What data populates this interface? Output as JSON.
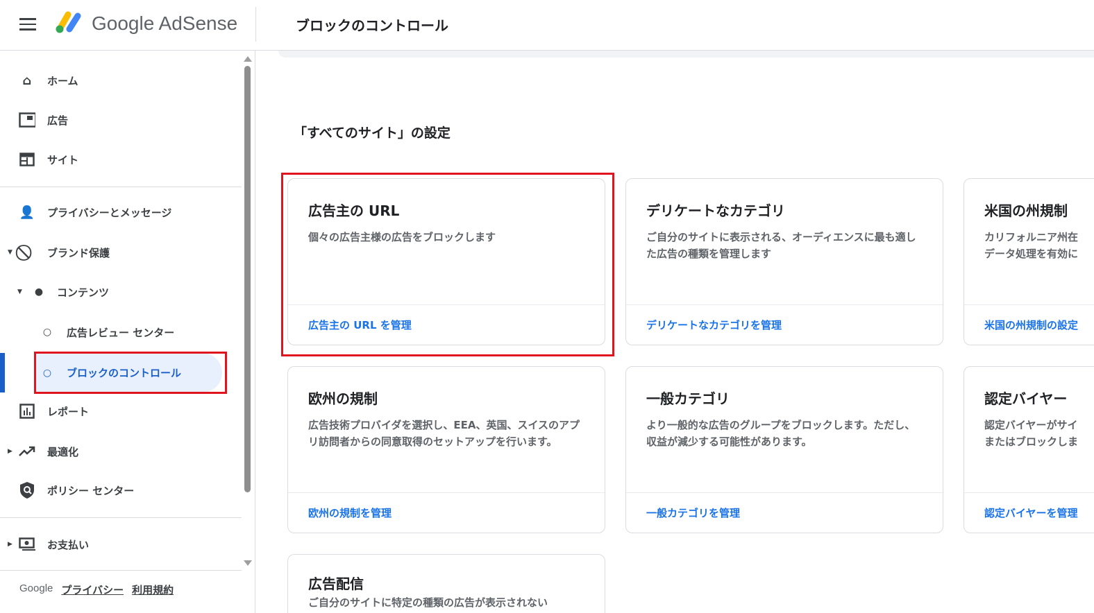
{
  "header": {
    "brand": "Google AdSense",
    "page_title": "ブロックのコントロール"
  },
  "sidebar": {
    "items": [
      {
        "label": "ホーム",
        "icon": "home-icon"
      },
      {
        "label": "広告",
        "icon": "ads-icon"
      },
      {
        "label": "サイト",
        "icon": "sites-icon"
      },
      {
        "label": "プライバシーとメッセージ",
        "icon": "privacy-icon"
      },
      {
        "label": "ブランド保護",
        "icon": "block-icon",
        "expanded": true
      },
      {
        "label": "コンテンツ",
        "icon": "dot-icon",
        "expanded": true
      },
      {
        "label": "広告レビュー センター",
        "icon": "circle-icon"
      },
      {
        "label": "ブロックのコントロール",
        "icon": "circle-icon",
        "active": true
      },
      {
        "label": "レポート",
        "icon": "chart-icon"
      },
      {
        "label": "最適化",
        "icon": "trend-icon",
        "expanded": false
      },
      {
        "label": "ポリシー センター",
        "icon": "policy-icon"
      },
      {
        "label": "お支払い",
        "icon": "payments-icon",
        "expanded": false
      }
    ],
    "footer": {
      "google": "Google",
      "privacy": "プライバシー",
      "terms": "利用規約"
    }
  },
  "main": {
    "section_title": "「すべてのサイト」の設定",
    "cards": [
      {
        "title": "広告主の URL",
        "desc": "個々の広告主様の広告をブロックします",
        "link": "広告主の URL を管理"
      },
      {
        "title": "デリケートなカテゴリ",
        "desc": "ご自分のサイトに表示される、オーディエンスに最も適した広告の種類を管理します",
        "link": "デリケートなカテゴリを管理"
      },
      {
        "title": "米国の州規制",
        "desc": "カリフォルニア州在データ処理を有効に",
        "link": "米国の州規制の設定"
      },
      {
        "title": "欧州の規制",
        "desc": "広告技術プロバイダを選択し、EEA、英国、スイスのアプリ訪問者からの同意取得のセットアップを行います。",
        "link": "欧州の規制を管理"
      },
      {
        "title": "一般カテゴリ",
        "desc": "より一般的な広告のグループをブロックします。ただし、収益が減少する可能性があります。",
        "link": "一般カテゴリを管理"
      },
      {
        "title": "認定バイヤー",
        "desc": "認定バイヤーがサイまたはブロックしま",
        "link": "認定バイヤーを管理"
      },
      {
        "title": "広告配信",
        "desc": "ご自分のサイトに特定の種類の広告が表示されない",
        "link": ""
      }
    ]
  },
  "colors": {
    "accent": "#1a73e8",
    "highlight": "#e0141e",
    "active_bg": "#e8f0fe"
  }
}
